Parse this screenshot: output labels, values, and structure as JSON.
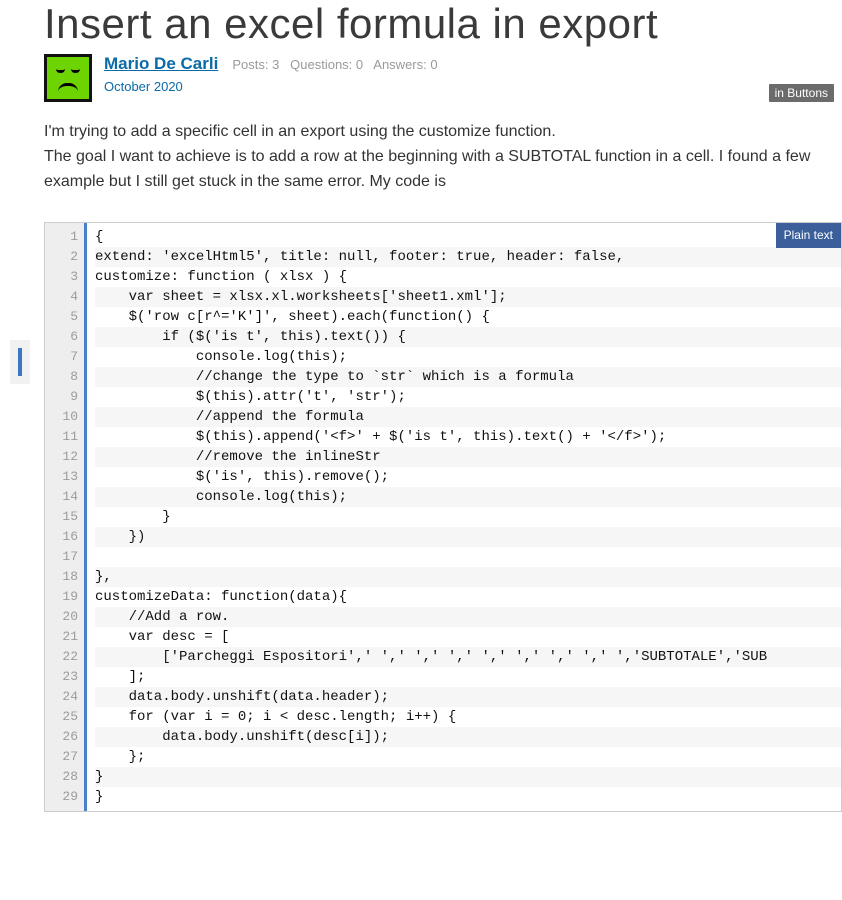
{
  "title": "Insert an excel formula in export",
  "author": {
    "name": "Mario De Carli"
  },
  "stats": {
    "posts_label": "Posts:",
    "posts": "3",
    "questions_label": "Questions:",
    "questions": "0",
    "answers_label": "Answers:",
    "answers": "0"
  },
  "date": "October 2020",
  "tag": {
    "prefix": "in",
    "name": "Buttons"
  },
  "body": "I'm trying to add a specific cell in an export using the customize function.\nThe goal I want to achieve is to add a row at the beginning with a SUBTOTAL function in a cell. I found a few example but I still get stuck in the same error. My code is",
  "code": {
    "plain_text_label": "Plain text",
    "lines": [
      "{",
      "extend: 'excelHtml5', title: null, footer: true, header: false,",
      "customize: function ( xlsx ) {",
      "    var sheet = xlsx.xl.worksheets['sheet1.xml'];",
      "    $('row c[r^='K']', sheet).each(function() {",
      "        if ($('is t', this).text()) {",
      "            console.log(this);",
      "            //change the type to `str` which is a formula",
      "            $(this).attr('t', 'str');",
      "            //append the formula",
      "            $(this).append('<f>' + $('is t', this).text() + '</f>');",
      "            //remove the inlineStr",
      "            $('is', this).remove();",
      "            console.log(this);",
      "        }",
      "    })",
      "",
      "},",
      "customizeData: function(data){",
      "    //Add a row.",
      "    var desc = [",
      "        ['Parcheggi Espositori',' ',' ',' ',' ',' ',' ',' ',' ','SUBTOTALE','SUB",
      "    ];",
      "    data.body.unshift(data.header);",
      "    for (var i = 0; i < desc.length; i++) {",
      "        data.body.unshift(desc[i]);",
      "    };",
      "}",
      "}"
    ]
  }
}
